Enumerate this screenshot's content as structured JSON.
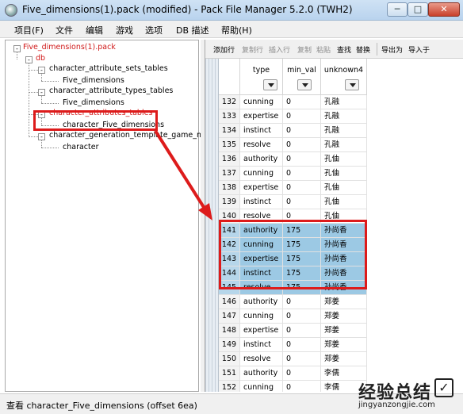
{
  "window": {
    "title": "Five_dimensions(1).pack (modified) - Pack File Manager 5.2.0 (TWH2)",
    "min_glyph": "─",
    "max_glyph": "□",
    "close_glyph": "✕"
  },
  "menu": [
    {
      "label": "项目(F)"
    },
    {
      "label": "文件"
    },
    {
      "label": "编辑"
    },
    {
      "label": "游戏"
    },
    {
      "label": "选项"
    },
    {
      "label": "DB 描述"
    },
    {
      "label": "帮助(H)"
    }
  ],
  "tree": {
    "nodes": [
      {
        "label": "Five_dimensions(1).pack",
        "expander": "-",
        "color": "#d01818"
      },
      {
        "label": "db",
        "expander": "-",
        "color": "#d01818"
      },
      {
        "label": "character_attribute_sets_tables",
        "expander": "-"
      },
      {
        "label": "Five_dimensions"
      },
      {
        "label": "character_attribute_types_tables",
        "expander": "-"
      },
      {
        "label": "Five_dimensions"
      },
      {
        "label": "character_attributes_tables",
        "expander": "-",
        "color": "#d01818"
      },
      {
        "label": "character_Five_dimensions"
      },
      {
        "label": "character_generation_template_game_mode_",
        "expander": "-"
      },
      {
        "label": "character"
      }
    ]
  },
  "toolbar": {
    "buttons": [
      {
        "label": "添加行",
        "enabled": true
      },
      {
        "label": "复制行",
        "enabled": false
      },
      {
        "label": "插入行",
        "enabled": false
      },
      {
        "label": "复制",
        "enabled": false
      },
      {
        "label": "粘贴",
        "enabled": false
      },
      {
        "label": "查找",
        "enabled": true
      },
      {
        "label": "替换",
        "enabled": true
      },
      {
        "label": "导出为",
        "enabled": true
      },
      {
        "label": "导入于",
        "enabled": true
      }
    ]
  },
  "grid": {
    "columns": [
      {
        "label": "type"
      },
      {
        "label": "min_val"
      },
      {
        "label": "unknown4"
      }
    ],
    "rows": [
      {
        "n": "132",
        "type": "cunning",
        "min_val": "0",
        "u4": "孔融",
        "sel": false
      },
      {
        "n": "133",
        "type": "expertise",
        "min_val": "0",
        "u4": "孔融",
        "sel": false
      },
      {
        "n": "134",
        "type": "instinct",
        "min_val": "0",
        "u4": "孔融",
        "sel": false
      },
      {
        "n": "135",
        "type": "resolve",
        "min_val": "0",
        "u4": "孔融",
        "sel": false
      },
      {
        "n": "136",
        "type": "authority",
        "min_val": "0",
        "u4": "孔伷",
        "sel": false
      },
      {
        "n": "137",
        "type": "cunning",
        "min_val": "0",
        "u4": "孔伷",
        "sel": false
      },
      {
        "n": "138",
        "type": "expertise",
        "min_val": "0",
        "u4": "孔伷",
        "sel": false
      },
      {
        "n": "139",
        "type": "instinct",
        "min_val": "0",
        "u4": "孔伷",
        "sel": false
      },
      {
        "n": "140",
        "type": "resolve",
        "min_val": "0",
        "u4": "孔伷",
        "sel": false
      },
      {
        "n": "141",
        "type": "authority",
        "min_val": "175",
        "u4": "孙尚香",
        "sel": true
      },
      {
        "n": "142",
        "type": "cunning",
        "min_val": "175",
        "u4": "孙尚香",
        "sel": true
      },
      {
        "n": "143",
        "type": "expertise",
        "min_val": "175",
        "u4": "孙尚香",
        "sel": true
      },
      {
        "n": "144",
        "type": "instinct",
        "min_val": "175",
        "u4": "孙尚香",
        "sel": true
      },
      {
        "n": "145",
        "type": "resolve",
        "min_val": "175",
        "u4": "孙尚香",
        "sel": true
      },
      {
        "n": "146",
        "type": "authority",
        "min_val": "0",
        "u4": "郑姜",
        "sel": false
      },
      {
        "n": "147",
        "type": "cunning",
        "min_val": "0",
        "u4": "郑姜",
        "sel": false
      },
      {
        "n": "148",
        "type": "expertise",
        "min_val": "0",
        "u4": "郑姜",
        "sel": false
      },
      {
        "n": "149",
        "type": "instinct",
        "min_val": "0",
        "u4": "郑姜",
        "sel": false
      },
      {
        "n": "150",
        "type": "resolve",
        "min_val": "0",
        "u4": "郑姜",
        "sel": false
      },
      {
        "n": "151",
        "type": "authority",
        "min_val": "0",
        "u4": "李儒",
        "sel": false
      },
      {
        "n": "152",
        "type": "cunning",
        "min_val": "0",
        "u4": "李儒",
        "sel": false
      }
    ]
  },
  "status": {
    "text": "查看 character_Five_dimensions (offset 6ea)"
  },
  "watermark": {
    "main": "经验总结",
    "check": "✓",
    "url": "jingyanzongjie.com"
  },
  "colors": {
    "selection": "#9cc9e4",
    "annotation": "#dd1b1b",
    "tree_red": "#d01818"
  }
}
